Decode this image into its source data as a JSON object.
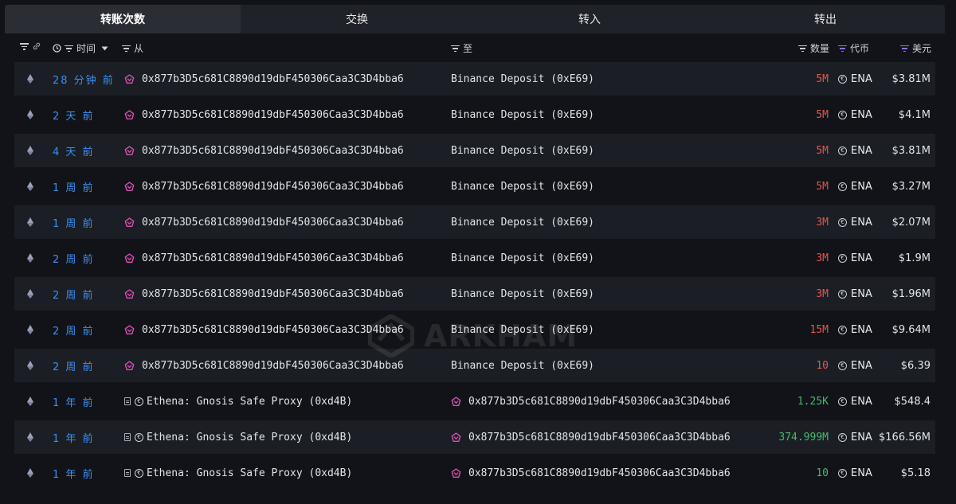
{
  "tabs": [
    {
      "label": "转账次数",
      "active": true
    },
    {
      "label": "交换",
      "active": false
    },
    {
      "label": "转入",
      "active": false
    },
    {
      "label": "转出",
      "active": false
    }
  ],
  "columns": {
    "time": "时间",
    "from": "从",
    "to": "至",
    "amount": "数量",
    "token": "代币",
    "usd": "美元"
  },
  "colors": {
    "accent_blue": "#3b8ff3",
    "amount_out": "#e2584c",
    "amount_in": "#49b86f",
    "filter_purple": "#8f6cf5",
    "address_icon_pink": "#d84fb0"
  },
  "watermark": "ARKHAM",
  "rows": [
    {
      "chain": "eth-icon",
      "time": "28 分钟 前",
      "from": "0x877b3D5c681C8890d19dbF450306Caa3C3D4bba6",
      "from_type": "address",
      "to": "Binance Deposit (0xE69)",
      "to_type": "entity",
      "amount": "5M",
      "direction": "out",
      "token": "ENA",
      "usd": "$3.81M"
    },
    {
      "chain": "eth-icon",
      "time": "2 天 前",
      "from": "0x877b3D5c681C8890d19dbF450306Caa3C3D4bba6",
      "from_type": "address",
      "to": "Binance Deposit (0xE69)",
      "to_type": "entity",
      "amount": "5M",
      "direction": "out",
      "token": "ENA",
      "usd": "$4.1M"
    },
    {
      "chain": "eth-icon",
      "time": "4 天 前",
      "from": "0x877b3D5c681C8890d19dbF450306Caa3C3D4bba6",
      "from_type": "address",
      "to": "Binance Deposit (0xE69)",
      "to_type": "entity",
      "amount": "5M",
      "direction": "out",
      "token": "ENA",
      "usd": "$3.81M"
    },
    {
      "chain": "eth-icon",
      "time": "1 周 前",
      "from": "0x877b3D5c681C8890d19dbF450306Caa3C3D4bba6",
      "from_type": "address",
      "to": "Binance Deposit (0xE69)",
      "to_type": "entity",
      "amount": "5M",
      "direction": "out",
      "token": "ENA",
      "usd": "$3.27M"
    },
    {
      "chain": "eth-icon",
      "time": "1 周 前",
      "from": "0x877b3D5c681C8890d19dbF450306Caa3C3D4bba6",
      "from_type": "address",
      "to": "Binance Deposit (0xE69)",
      "to_type": "entity",
      "amount": "3M",
      "direction": "out",
      "token": "ENA",
      "usd": "$2.07M"
    },
    {
      "chain": "eth-icon",
      "time": "2 周 前",
      "from": "0x877b3D5c681C8890d19dbF450306Caa3C3D4bba6",
      "from_type": "address",
      "to": "Binance Deposit (0xE69)",
      "to_type": "entity",
      "amount": "3M",
      "direction": "out",
      "token": "ENA",
      "usd": "$1.9M"
    },
    {
      "chain": "eth-icon",
      "time": "2 周 前",
      "from": "0x877b3D5c681C8890d19dbF450306Caa3C3D4bba6",
      "from_type": "address",
      "to": "Binance Deposit (0xE69)",
      "to_type": "entity",
      "amount": "3M",
      "direction": "out",
      "token": "ENA",
      "usd": "$1.96M"
    },
    {
      "chain": "eth-icon",
      "time": "2 周 前",
      "from": "0x877b3D5c681C8890d19dbF450306Caa3C3D4bba6",
      "from_type": "address",
      "to": "Binance Deposit (0xE69)",
      "to_type": "entity",
      "amount": "15M",
      "direction": "out",
      "token": "ENA",
      "usd": "$9.64M"
    },
    {
      "chain": "eth-icon",
      "time": "2 周 前",
      "from": "0x877b3D5c681C8890d19dbF450306Caa3C3D4bba6",
      "from_type": "address",
      "to": "Binance Deposit (0xE69)",
      "to_type": "entity",
      "amount": "10",
      "direction": "out",
      "token": "ENA",
      "usd": "$6.39"
    },
    {
      "chain": "eth-icon",
      "time": "1 年 前",
      "from": "Ethena: Gnosis Safe Proxy (0xd4B)",
      "from_type": "contract",
      "to": "0x877b3D5c681C8890d19dbF450306Caa3C3D4bba6",
      "to_type": "address",
      "amount": "1.25K",
      "direction": "in",
      "token": "ENA",
      "usd": "$548.4"
    },
    {
      "chain": "eth-icon",
      "time": "1 年 前",
      "from": "Ethena: Gnosis Safe Proxy (0xd4B)",
      "from_type": "contract",
      "to": "0x877b3D5c681C8890d19dbF450306Caa3C3D4bba6",
      "to_type": "address",
      "amount": "374.999M",
      "direction": "in",
      "token": "ENA",
      "usd": "$166.56M"
    },
    {
      "chain": "eth-icon",
      "time": "1 年 前",
      "from": "Ethena: Gnosis Safe Proxy (0xd4B)",
      "from_type": "contract",
      "to": "0x877b3D5c681C8890d19dbF450306Caa3C3D4bba6",
      "to_type": "address",
      "amount": "10",
      "direction": "in",
      "token": "ENA",
      "usd": "$5.18"
    }
  ]
}
